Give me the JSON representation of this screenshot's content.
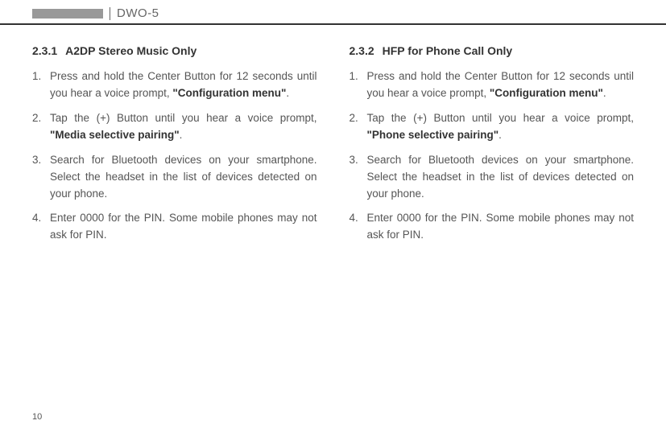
{
  "header": {
    "model": "DWO-5"
  },
  "left": {
    "heading_num": "2.3.1",
    "heading_text": "A2DP Stereo Music Only",
    "steps": [
      {
        "pre": "Press and hold the Center Button for 12 seconds until you hear a voice prompt, ",
        "bold": "\"Configuration menu\"",
        "post": "."
      },
      {
        "pre": "Tap the (+) Button until you hear a voice prompt, ",
        "bold": "\"Media selective pairing\"",
        "post": "."
      },
      {
        "pre": "Search for Bluetooth devices on your smartphone. Select the headset in the list of devices detected on your phone.",
        "bold": "",
        "post": ""
      },
      {
        "pre": "Enter 0000 for the PIN. Some mobile phones may not ask for PIN.",
        "bold": "",
        "post": ""
      }
    ]
  },
  "right": {
    "heading_num": "2.3.2",
    "heading_text": "HFP for Phone Call Only",
    "steps": [
      {
        "pre": "Press and hold the Center Button for 12 seconds until you hear a voice prompt, ",
        "bold": "\"Configuration menu\"",
        "post": "."
      },
      {
        "pre": "Tap the (+) Button until you hear a voice prompt, ",
        "bold": "\"Phone selective pairing\"",
        "post": "."
      },
      {
        "pre": "Search for Bluetooth devices on your smartphone. Select the headset in the list of devices detected on your phone.",
        "bold": "",
        "post": ""
      },
      {
        "pre": "Enter 0000 for the PIN. Some mobile phones may not ask for PIN.",
        "bold": "",
        "post": ""
      }
    ]
  },
  "page_number": "10"
}
